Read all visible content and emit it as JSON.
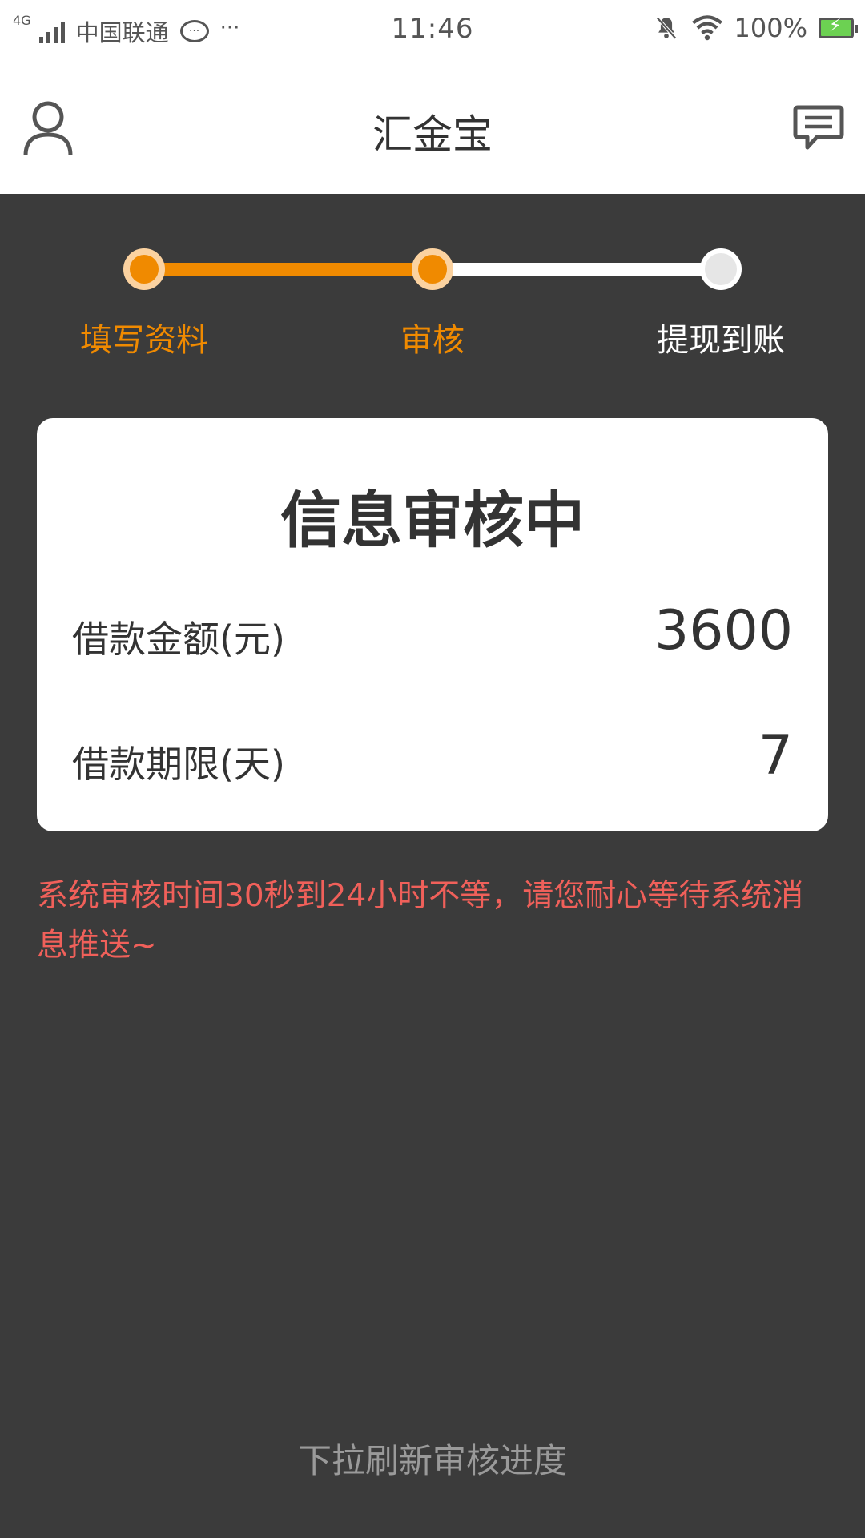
{
  "status_bar": {
    "network_type": "4G",
    "carrier": "中国联通",
    "more": "···",
    "time": "11:46",
    "battery_percent": "100%",
    "icons": [
      "signal-icon",
      "chat-bubble-icon",
      "bell-muted-icon",
      "wifi-icon",
      "battery-charging-icon"
    ]
  },
  "app_bar": {
    "title": "汇金宝",
    "left_icon": "user-icon",
    "right_icon": "message-icon"
  },
  "steps": {
    "items": [
      {
        "label": "填写资料",
        "state": "done"
      },
      {
        "label": "审核",
        "state": "current"
      },
      {
        "label": "提现到账",
        "state": "pending"
      }
    ],
    "active_color": "#f08a00",
    "inactive_color": "#ffffff"
  },
  "card": {
    "title": "信息审核中",
    "rows": [
      {
        "label": "借款金额(元)",
        "value": "3600"
      },
      {
        "label": "借款期限(天)",
        "value": "7"
      }
    ]
  },
  "notice": "系统审核时间30秒到24小时不等，请您耐心等待系统消息推送~",
  "refresh_hint": "下拉刷新审核进度",
  "colors": {
    "background": "#3b3b3b",
    "accent": "#f08a00",
    "notice": "#f0605a"
  }
}
